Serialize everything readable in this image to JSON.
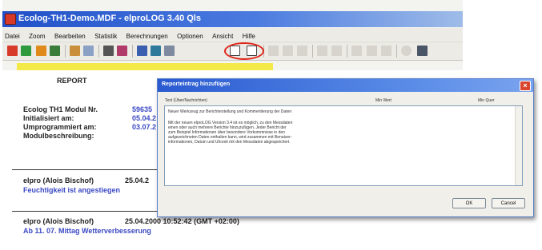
{
  "window": {
    "title": "Ecolog-TH1-Demo.MDF - elproLOG 3.40 Qls",
    "menu": [
      "Datei",
      "Zoom",
      "Bearbeiten",
      "Statistik",
      "Berechnungen",
      "Optionen",
      "Ansicht",
      "Hilfe"
    ]
  },
  "toolbar": {
    "icons": [
      "tool-red-icon",
      "tool-green-icon",
      "tool-orange-icon",
      "tool-grid-icon",
      "open-icon",
      "save-icon",
      "print-icon",
      "report-icon",
      "chart-icon",
      "table-icon",
      "page-icon",
      "report-entry-icon",
      "copy-entry-icon",
      "icon-a",
      "icon-b",
      "icon-c",
      "icon-d",
      "icon-e",
      "icon-f",
      "icon-g",
      "icon-h",
      "icon-i",
      "icon-j"
    ],
    "colors": {
      "red": "#d83a2a",
      "green": "#2e9a3d",
      "orange": "#e08a1c",
      "highlight_circle": "#e0261b"
    }
  },
  "report": {
    "heading": "REPORT",
    "fields": [
      {
        "label": "Ecolog TH1 Modul Nr.",
        "value": "59635"
      },
      {
        "label": "Initialisiert am:",
        "value": "05.04.2"
      },
      {
        "label": "Umprogrammiert am:",
        "value": "03.07.2"
      },
      {
        "label": "Modulbeschreibung:",
        "value": ""
      }
    ],
    "entries": [
      {
        "author": "elpro (Alois Bischof)",
        "datetime": "25.04.2",
        "text": "Feuchtigkeit ist angestiegen"
      },
      {
        "author": "elpro (Alois Bischof)",
        "datetime": "25.04.2000 10:52:42 (GMT +02:00)",
        "text": "Ab 11. 07. Mittag Wetterverbesserung"
      }
    ]
  },
  "dialog": {
    "title": "Reporteintrag hinzufügen",
    "col_text": "Text (Über/Nachrichten)",
    "col_min": "Min Wert",
    "col_max": "Min Quer",
    "body_lines": [
      "Neuer Werkzeug zur Berichterstellung und Kommentierung der Daten",
      "",
      "Mit der neuen elproLOG Version 3.4 ist es möglich, zu den Messdaten",
      "einen oder auch mehrere Berichte hinzuzufügen. Jeder Bericht der",
      "zum Beispiel Informationen über besondere Vorkommnisse in den",
      "aufgezeichneten Daten enthalten kann, wird zusammen mit Benutzer-",
      "informationen, Datum und Uhrzeit mit den Messdaten abgespeichert."
    ],
    "ok": "OK",
    "cancel": "Cancel"
  }
}
